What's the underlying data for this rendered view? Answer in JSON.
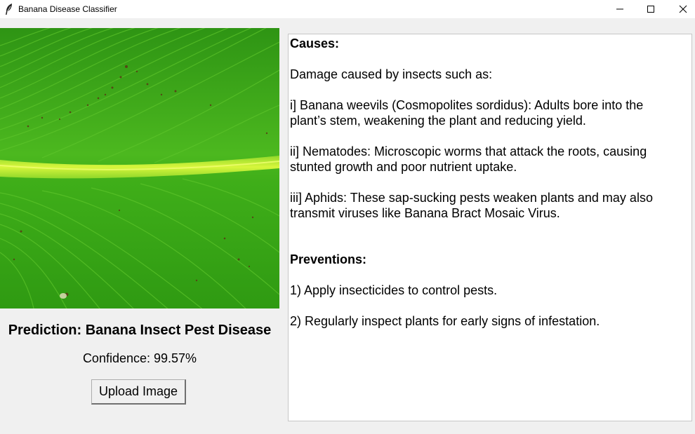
{
  "window": {
    "title": "Banana Disease Classifier",
    "minimize_icon": "minimize-icon",
    "maximize_icon": "maximize-icon",
    "close_icon": "close-icon",
    "app_icon": "feather-icon"
  },
  "left_panel": {
    "image_description_icon": "banana-leaf-image",
    "prediction": "Prediction: Banana Insect Pest Disease",
    "confidence": "Confidence: 99.57%",
    "upload_button_label": "Upload Image"
  },
  "info_panel": {
    "causes_heading": "Causes:",
    "causes_intro": "Damage caused by insects such as:",
    "cause_1_line_1": "i] Banana weevils (Cosmopolites sordidus): Adults bore into the",
    "cause_1_line_2": "plant’s stem, weakening the plant and reducing yield.",
    "cause_2_line_1": "ii] Nematodes: Microscopic worms that attack the roots, causing",
    "cause_2_line_2": "stunted growth and poor nutrient uptake.",
    "cause_3_line_1": "iii] Aphids: These sap-sucking pests weaken plants and may also",
    "cause_3_line_2": "transmit viruses like Banana Bract Mosaic Virus.",
    "preventions_heading": "Preventions:",
    "prevention_1": "1) Apply insecticides to control pests.",
    "prevention_2": "2) Regularly inspect plants for early signs of infestation."
  },
  "colors": {
    "window_bg": "#f0f0f0",
    "titlebar_bg": "#ffffff",
    "panel_bg": "#ffffff",
    "leaf_green": "#3aa51a",
    "midrib": "#c8f03a"
  }
}
